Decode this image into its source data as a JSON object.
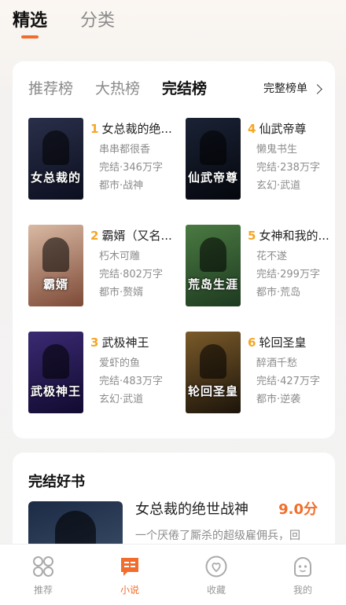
{
  "top_tabs": [
    "精选",
    "分类"
  ],
  "ranking": {
    "tabs": [
      "推荐榜",
      "大热榜",
      "完结榜"
    ],
    "full_list_label": "完整榜单",
    "books": [
      {
        "rank": "1",
        "title": "女总裁的绝...",
        "author": "串串都很香",
        "status": "完结·346万字",
        "genre": "都市·战神",
        "cover_text": "女总裁的",
        "cover_colors": [
          "#2a2f4a",
          "#0c0f1f"
        ]
      },
      {
        "rank": "4",
        "title": "仙武帝尊",
        "author": "懒鬼书生",
        "status": "完结·238万字",
        "genre": "玄幻·武道",
        "cover_text": "仙武帝尊",
        "cover_colors": [
          "#1a2235",
          "#05070d"
        ]
      },
      {
        "rank": "2",
        "title": "霸婿（又名...",
        "author": "朽木可雕",
        "status": "完结·802万字",
        "genre": "都市·赘婿",
        "cover_text": "霸婿",
        "cover_colors": [
          "#d9b9a3",
          "#7d4a37"
        ]
      },
      {
        "rank": "5",
        "title": "女神和我的...",
        "author": "花不遂",
        "status": "完结·299万字",
        "genre": "都市·荒岛",
        "cover_text": "荒岛生涯",
        "cover_colors": [
          "#4a7a42",
          "#1e3a20"
        ]
      },
      {
        "rank": "3",
        "title": "武极神王",
        "author": "爱虾的鱼",
        "status": "完结·483万字",
        "genre": "玄幻·武道",
        "cover_text": "武极神王",
        "cover_colors": [
          "#3a2a72",
          "#120a30"
        ]
      },
      {
        "rank": "6",
        "title": "轮回圣皇",
        "author": "醉酒千愁",
        "status": "完结·427万字",
        "genre": "都市·逆袭",
        "cover_text": "轮回圣皇",
        "cover_colors": [
          "#7a5a2a",
          "#1c140a"
        ]
      }
    ]
  },
  "good_books": {
    "title": "完结好书",
    "book_name": "女总裁的绝世战神",
    "score": "9.0分",
    "desc": "一个厌倦了厮杀的超级雇佣兵，回"
  },
  "bottom_nav": [
    {
      "label": "推荐",
      "icon": "grid-icon"
    },
    {
      "label": "小说",
      "icon": "book-chat-icon"
    },
    {
      "label": "收藏",
      "icon": "heart-icon"
    },
    {
      "label": "我的",
      "icon": "user-icon"
    }
  ],
  "colors": {
    "accent": "#f26d2b",
    "rank_number": "#f5a623"
  }
}
